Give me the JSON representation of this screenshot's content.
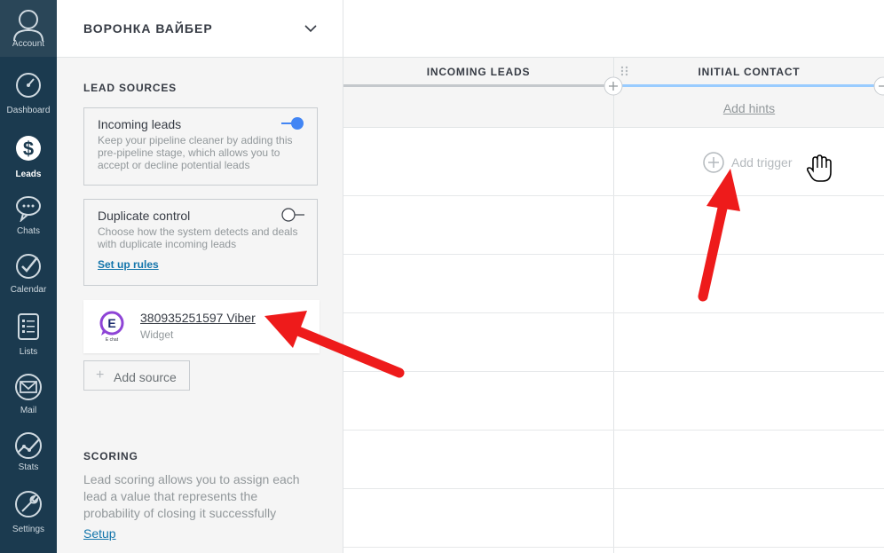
{
  "nav": {
    "account_label": "Account",
    "items": [
      {
        "label": "Dashboard",
        "icon": "dashboard-icon"
      },
      {
        "label": "Leads",
        "icon": "leads-dollar-icon",
        "active": true
      },
      {
        "label": "Chats",
        "icon": "chat-bubble-icon"
      },
      {
        "label": "Calendar",
        "icon": "calendar-check-icon"
      },
      {
        "label": "Lists",
        "icon": "list-icon"
      },
      {
        "label": "Mail",
        "icon": "mail-envelope-icon"
      },
      {
        "label": "Stats",
        "icon": "stats-graph-icon"
      },
      {
        "label": "Settings",
        "icon": "wrench-icon"
      }
    ]
  },
  "sidebar": {
    "pipeline_name": "ВОРОНКА ВАЙБЕР",
    "lead_sources_title": "LEAD SOURCES",
    "incoming_leads": {
      "title": "Incoming leads",
      "description": "Keep your pipeline cleaner by adding this pre-pipeline stage, which allows you to accept or decline potential leads",
      "enabled": true
    },
    "duplicate_control": {
      "title": "Duplicate control",
      "description": "Choose how the system detects and deals with duplicate incoming leads",
      "link": "Set up rules",
      "enabled": false
    },
    "source_widget": {
      "name": "380935251597 Viber",
      "type": "Widget",
      "logo_letter": "E",
      "logo_caption": "E chat"
    },
    "add_source_label": "Add source",
    "scoring_title": "SCORING",
    "scoring_description": "Lead scoring allows you to assign each lead a value that represents the probability of closing it successfully",
    "scoring_setup_link": "Setup"
  },
  "board": {
    "columns": [
      {
        "name": "INCOMING LEADS",
        "bar_color": "#c4c8cc"
      },
      {
        "name": "INITIAL CONTACT",
        "bar_color": "#99ccff",
        "hints_link": "Add hints",
        "trigger_label": "Add trigger"
      }
    ]
  },
  "colors": {
    "nav_bg": "#1b3a4f",
    "accent": "#4285f4",
    "link": "#1375ab",
    "annotation_arrow": "#ee1b1b"
  }
}
